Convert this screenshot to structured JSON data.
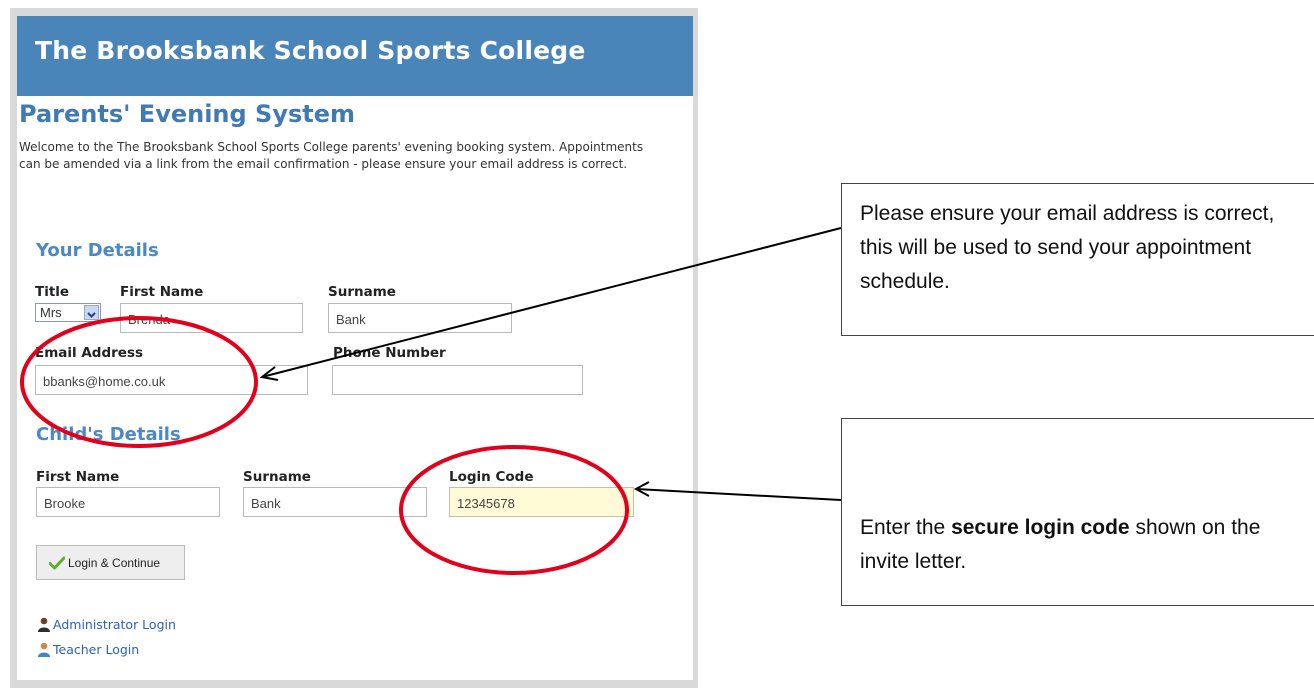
{
  "header": {
    "title": "The Brooksbank School Sports College"
  },
  "page": {
    "heading": "Parents' Evening System",
    "intro": "Welcome to the The Brooksbank School Sports College parents' evening booking system. Appointments can be amended via a link from the email confirmation - please ensure your email address is correct."
  },
  "your_details": {
    "heading": "Your Details",
    "title_label": "Title",
    "title_value": "Mrs",
    "first_name_label": "First Name",
    "first_name_value": "Brenda",
    "surname_label": "Surname",
    "surname_value": "Bank",
    "email_label": "Email Address",
    "email_value": "bbanks@home.co.uk",
    "phone_label": "Phone Number",
    "phone_value": ""
  },
  "child_details": {
    "heading": "Child's Details",
    "first_name_label": "First Name",
    "first_name_value": "Brooke",
    "surname_label": "Surname",
    "surname_value": "Bank",
    "login_code_label": "Login Code",
    "login_code_value": "12345678"
  },
  "actions": {
    "login_label": "Login & Continue"
  },
  "links": {
    "admin": "Administrator Login",
    "teacher": "Teacher Login"
  },
  "callouts": {
    "email": "Please ensure your email address is correct, this will be used to send your appointment schedule.",
    "code_prefix": "Enter the ",
    "code_bold": "secure login code",
    "code_suffix": " shown on the invite letter."
  },
  "colors": {
    "header": "#4a85b9",
    "heading": "#3f7ab5",
    "annotation_red": "#e3001b",
    "link": "#2b62b8",
    "highlight_field": "#fffbd7"
  }
}
